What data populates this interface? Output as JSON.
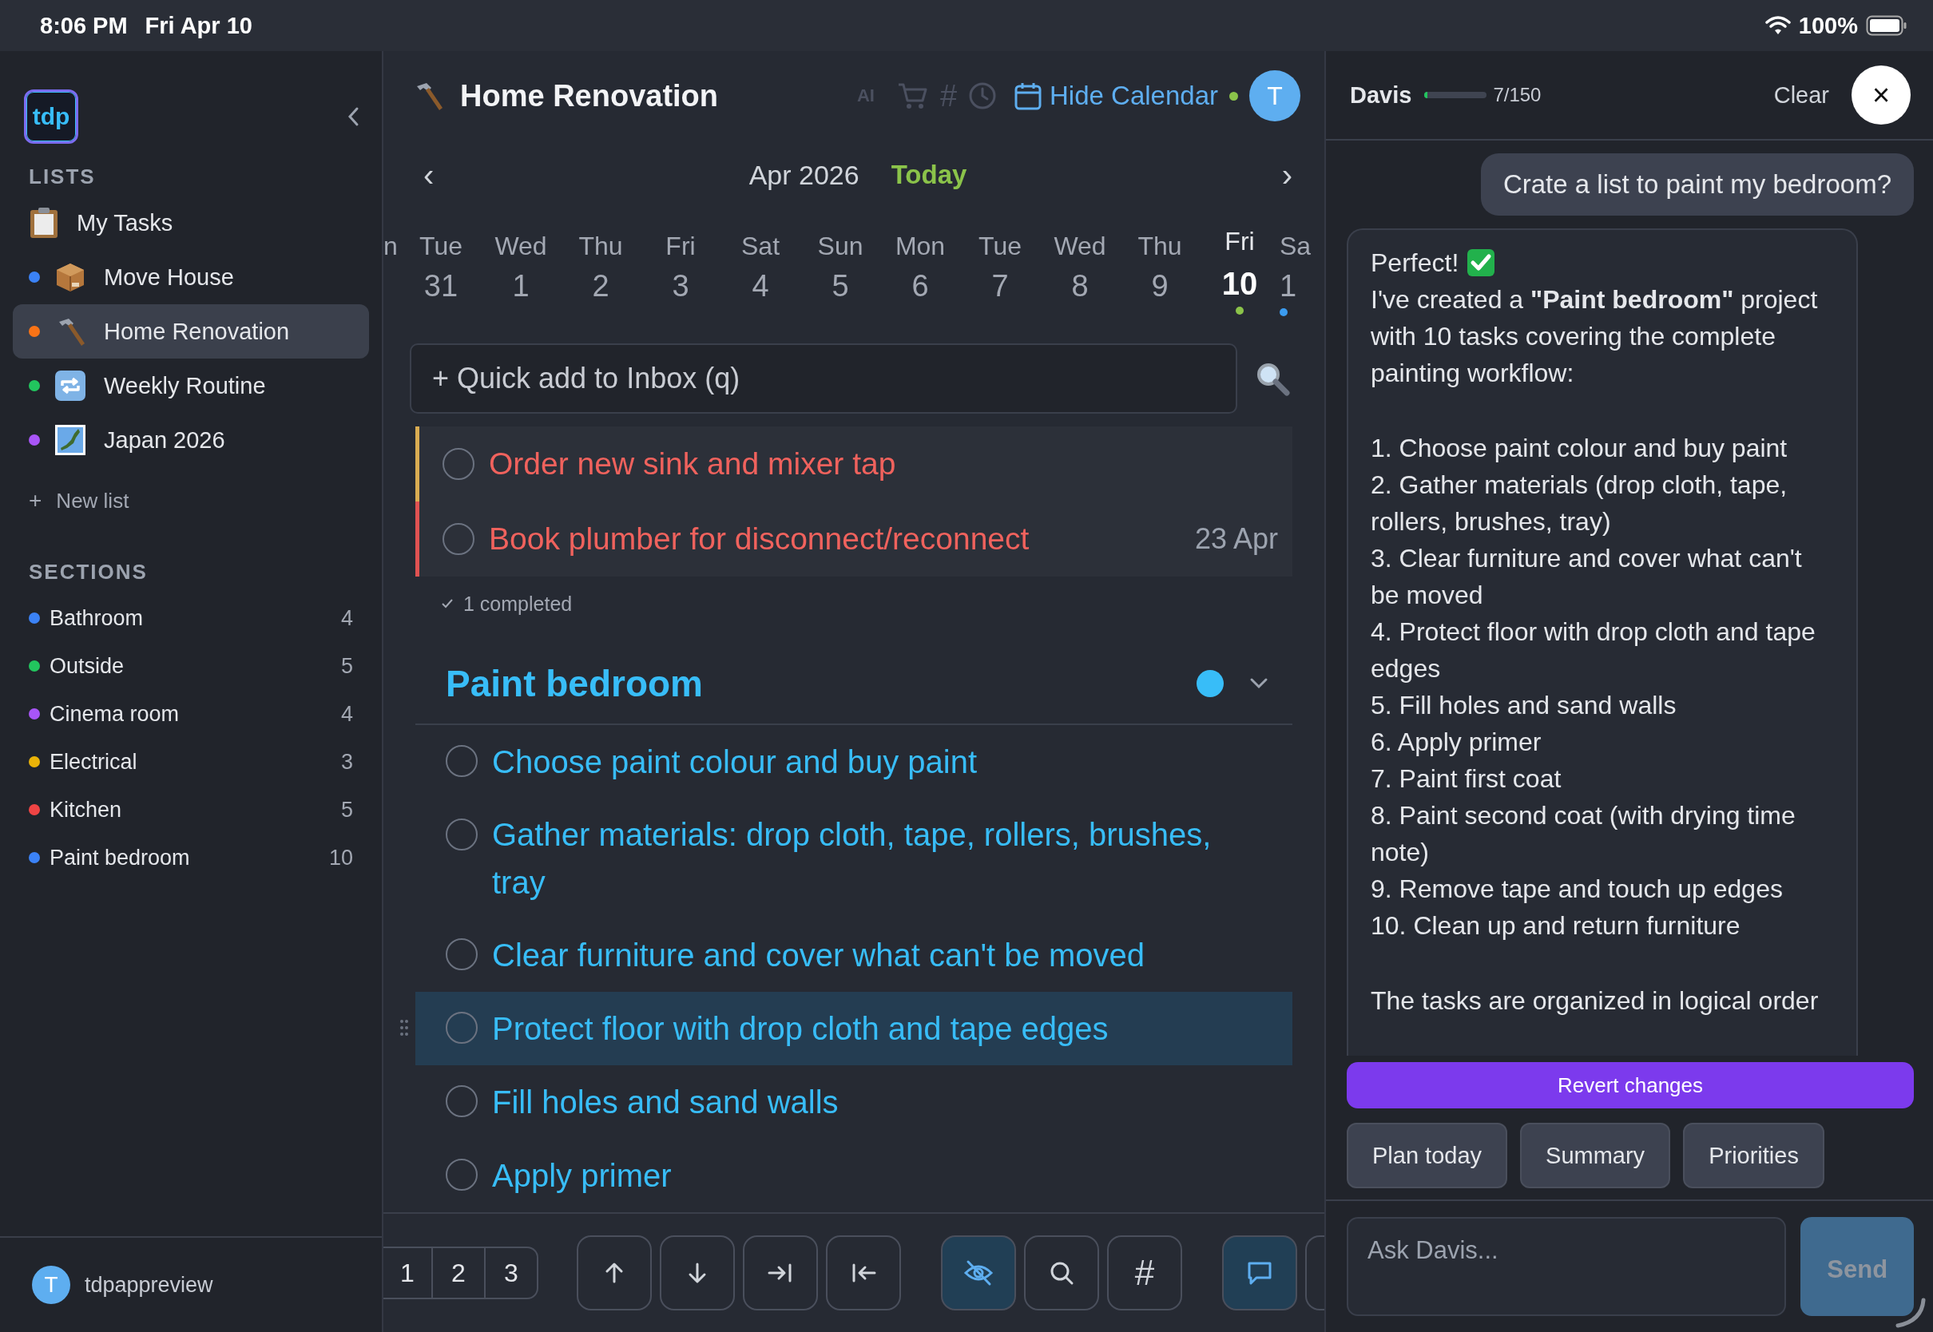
{
  "status_bar": {
    "time": "8:06 PM",
    "date": "Fri Apr 10",
    "battery": "100%"
  },
  "sidebar": {
    "logo": "tdp",
    "lists_heading": "LISTS",
    "lists": [
      {
        "label": "My Tasks",
        "selected": false
      },
      {
        "label": "Move House",
        "color": "#3b82f6",
        "selected": false
      },
      {
        "label": "Home Renovation",
        "color": "#f97316",
        "selected": true
      },
      {
        "label": "Weekly Routine",
        "color": "#22c55e",
        "selected": false
      },
      {
        "label": "Japan 2026",
        "color": "#a855f7",
        "selected": false
      }
    ],
    "new_list_symbol": "+",
    "new_list": "New list",
    "sections_heading": "SECTIONS",
    "sections": [
      {
        "label": "Bathroom",
        "count": "4",
        "color": "#3b82f6"
      },
      {
        "label": "Outside",
        "count": "5",
        "color": "#22c55e"
      },
      {
        "label": "Cinema room",
        "count": "4",
        "color": "#a855f7"
      },
      {
        "label": "Electrical",
        "count": "3",
        "color": "#eab308"
      },
      {
        "label": "Kitchen",
        "count": "5",
        "color": "#ef4444"
      },
      {
        "label": "Paint bedroom",
        "count": "10",
        "color": "#3b82f6"
      }
    ],
    "user": {
      "avatar": "T",
      "name": "tdpappreview"
    }
  },
  "main": {
    "title": "Home Renovation",
    "ai_label": "AI",
    "tag_symbol": "#",
    "calendar_toggle": "Hide Calendar",
    "avatar": "T",
    "calendar": {
      "prev": "‹",
      "month": "Apr 2026",
      "today": "Today",
      "next": "›",
      "days": [
        {
          "weekday": "n",
          "selected": false
        },
        {
          "weekday": "Tue",
          "day": "31",
          "selected": false
        },
        {
          "weekday": "Wed",
          "day": "1",
          "selected": false
        },
        {
          "weekday": "Thu",
          "day": "2",
          "selected": false
        },
        {
          "weekday": "Fri",
          "day": "3",
          "selected": false
        },
        {
          "weekday": "Sat",
          "day": "4",
          "selected": false
        },
        {
          "weekday": "Sun",
          "day": "5",
          "selected": false
        },
        {
          "weekday": "Mon",
          "day": "6",
          "selected": false
        },
        {
          "weekday": "Tue",
          "day": "7",
          "selected": false
        },
        {
          "weekday": "Wed",
          "day": "8",
          "selected": false
        },
        {
          "weekday": "Thu",
          "day": "9",
          "selected": false
        },
        {
          "weekday": "Fri",
          "day": "10",
          "selected": true,
          "color": "#8bc34a"
        },
        {
          "weekday": "Sa",
          "day": "1",
          "selected": false,
          "color": "#3b9cf0"
        }
      ]
    },
    "quick_add": {
      "placeholder": "+ Quick add to Inbox (q)"
    },
    "tasks": [
      {
        "title": "Order new sink and mixer tap",
        "color": "#d9ac52"
      },
      {
        "title": "Book plumber for disconnect/reconnect",
        "date": "23 Apr",
        "color": "#e05252"
      }
    ],
    "completed": "1 completed",
    "section": {
      "title": "Paint bedroom",
      "color": "#38bdf8",
      "expanded": true,
      "tasks": [
        {
          "title": "Choose paint colour and buy paint",
          "selected": false
        },
        {
          "title": "Gather materials: drop cloth, tape, rollers, brushes, tray",
          "selected": false
        },
        {
          "title": "Clear furniture and cover what can't be moved",
          "selected": false
        },
        {
          "title": "Protect floor with drop cloth and tape edges",
          "selected": true
        },
        {
          "title": "Fill holes and sand walls",
          "selected": false
        },
        {
          "title": "Apply primer",
          "selected": false
        }
      ]
    },
    "toolbar": {
      "pages": [
        "1",
        "2",
        "3"
      ],
      "buttons": [
        {
          "kind": "icon",
          "on": false
        },
        {
          "kind": "icon",
          "on": false
        },
        {
          "kind": "icon",
          "on": false
        },
        {
          "kind": "icon",
          "on": false
        },
        {
          "kind": "icon",
          "on": true
        },
        {
          "kind": "icon",
          "on": false
        },
        {
          "kind": "text",
          "label": "#",
          "on": false
        },
        {
          "kind": "icon",
          "on": true
        },
        {
          "kind": "partial",
          "on": false
        }
      ]
    }
  },
  "chat": {
    "name": "Davis",
    "progress": {
      "level": 0.047
    },
    "usage": "7/150",
    "clear": "Clear",
    "close": "×",
    "user_message": {
      "text": "Crate a list to paint my bedroom?"
    },
    "reply": {
      "before": "Perfect!",
      "after": "I've created a **\"Paint bedroom\"** project with 10 tasks covering the complete painting workflow:",
      "items": [
        "1. Choose paint colour and buy paint",
        "2. Gather materials (drop cloth, tape, rollers, brushes, tray)",
        "3. Clear furniture and cover what can't be moved",
        "4. Protect floor with drop cloth and tape edges",
        "5. Fill holes and sand walls",
        "6. Apply primer",
        "7. Paint first coat",
        "8. Paint second coat (with drying time note)",
        "9. Remove tape and touch up edges",
        "10. Clean up and return furniture"
      ],
      "footer": "The tasks are organized in logical order"
    },
    "revert": "Revert changes",
    "chips": [
      "Plan today",
      "Summary",
      "Priorities"
    ],
    "input": {
      "placeholder": "Ask Davis..."
    },
    "send": "Send"
  }
}
